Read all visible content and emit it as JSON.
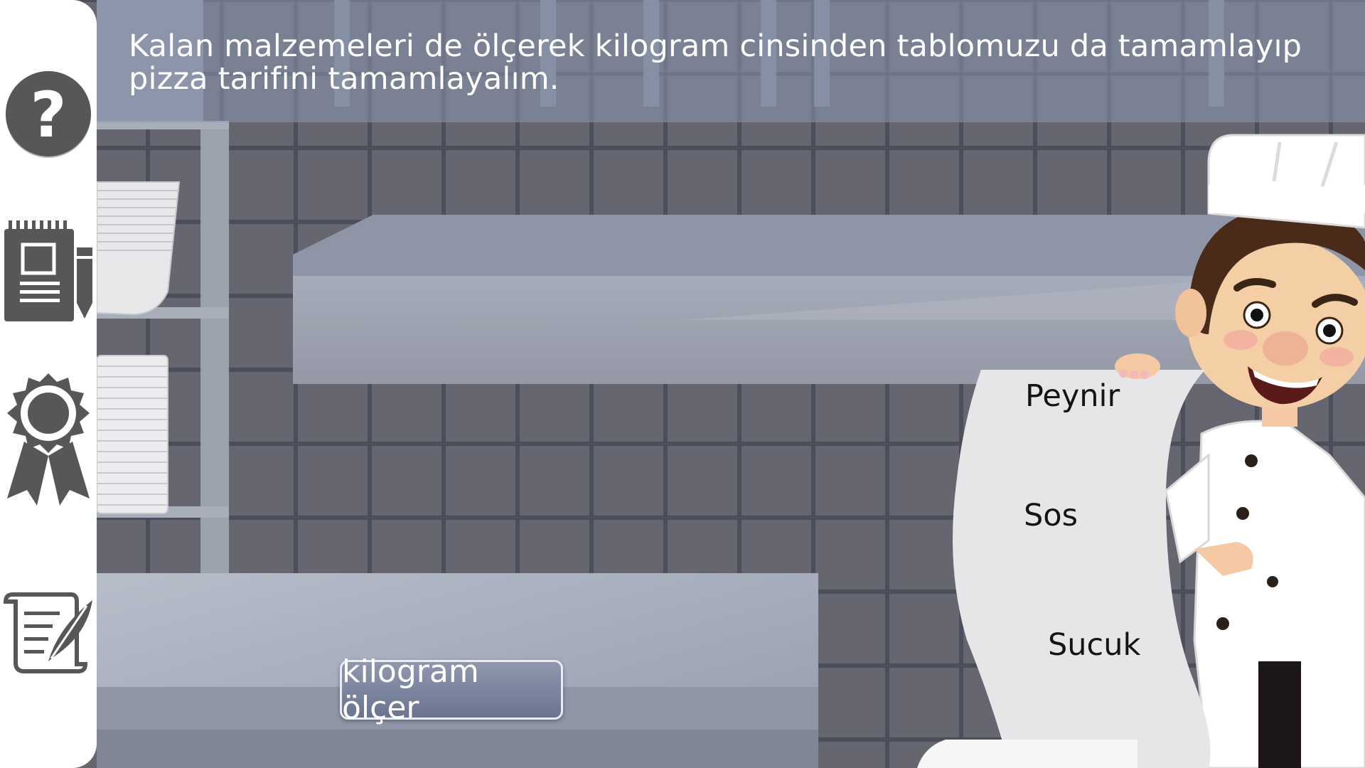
{
  "instruction": "Kalan malzemeleri de ölçerek kilogram cinsinden tablomuzu da tamamlayıp pizza tarifini tamamlayalım.",
  "measure_button_label": "kilogram ölçer",
  "recipe_items": [
    "Peynir",
    "Sos",
    "Sucuk"
  ],
  "sidebar": {
    "items": [
      {
        "name": "help",
        "icon": "question-mark-icon"
      },
      {
        "name": "notes",
        "icon": "notepad-pencil-icon"
      },
      {
        "name": "achievements",
        "icon": "award-ribbon-icon"
      },
      {
        "name": "recipe",
        "icon": "scroll-quill-icon"
      }
    ]
  },
  "colors": {
    "tile_wall": "#5f6070",
    "tile_grout": "#4d4e5c",
    "counter": "#a5adbd",
    "icon_gray": "#555555",
    "text_white": "#ffffff"
  }
}
